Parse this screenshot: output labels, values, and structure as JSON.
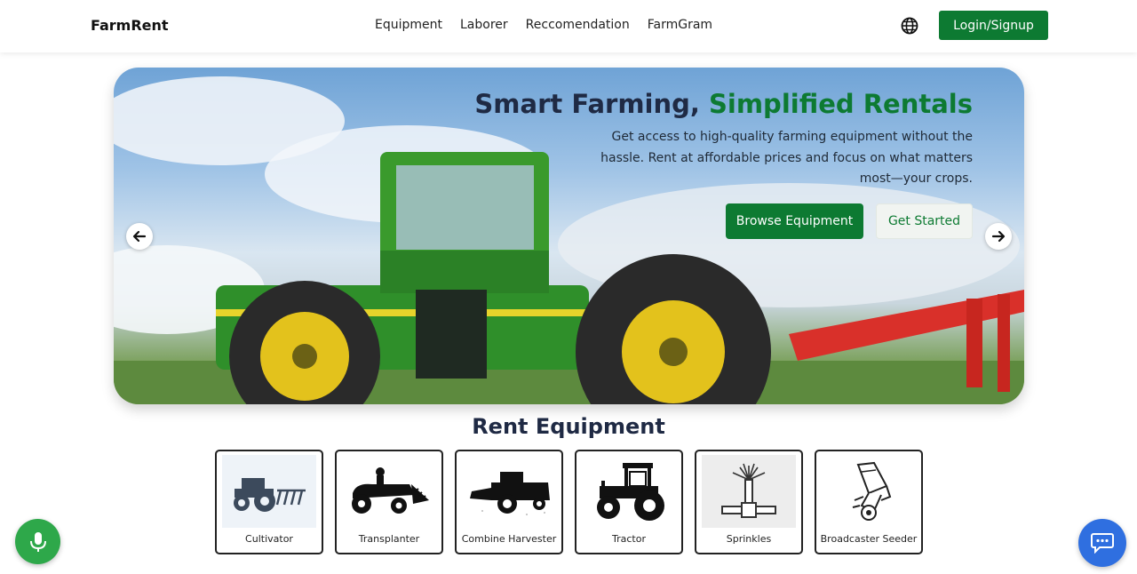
{
  "header": {
    "brand": "FarmRent",
    "nav": [
      "Equipment",
      "Laborer",
      "Reccomendation",
      "FarmGram"
    ],
    "language_icon": "globe-icon",
    "login_label": "Login/Signup"
  },
  "hero": {
    "title_part1": "Smart Farming, ",
    "title_part2": "Simplified Rentals",
    "description": "Get access to high-quality farming equipment without the hassle. Rent at affordable prices and focus on what matters most—your crops.",
    "browse_label": "Browse Equipment",
    "start_label": "Get Started",
    "prev_icon": "arrow-left-icon",
    "next_icon": "arrow-right-icon",
    "image": "green-tractor-photo"
  },
  "equipment": {
    "title": "Rent Equipment",
    "items": [
      {
        "label": "Cultivator",
        "icon": "cultivator-icon"
      },
      {
        "label": "Transplanter",
        "icon": "transplanter-icon"
      },
      {
        "label": "Combine Harvester",
        "icon": "combine-harvester-icon"
      },
      {
        "label": "Tractor",
        "icon": "tractor-icon"
      },
      {
        "label": "Sprinkles",
        "icon": "sprinkler-icon"
      },
      {
        "label": "Broadcaster Seeder",
        "icon": "broadcaster-seeder-icon"
      }
    ]
  },
  "floating": {
    "mic_icon": "microphone-icon",
    "chat_icon": "chat-icon"
  },
  "colors": {
    "brand_green": "#0d7a32",
    "heading": "#1f2a44",
    "mic_green": "#2ea84a",
    "chat_blue": "#2f6fe0"
  }
}
